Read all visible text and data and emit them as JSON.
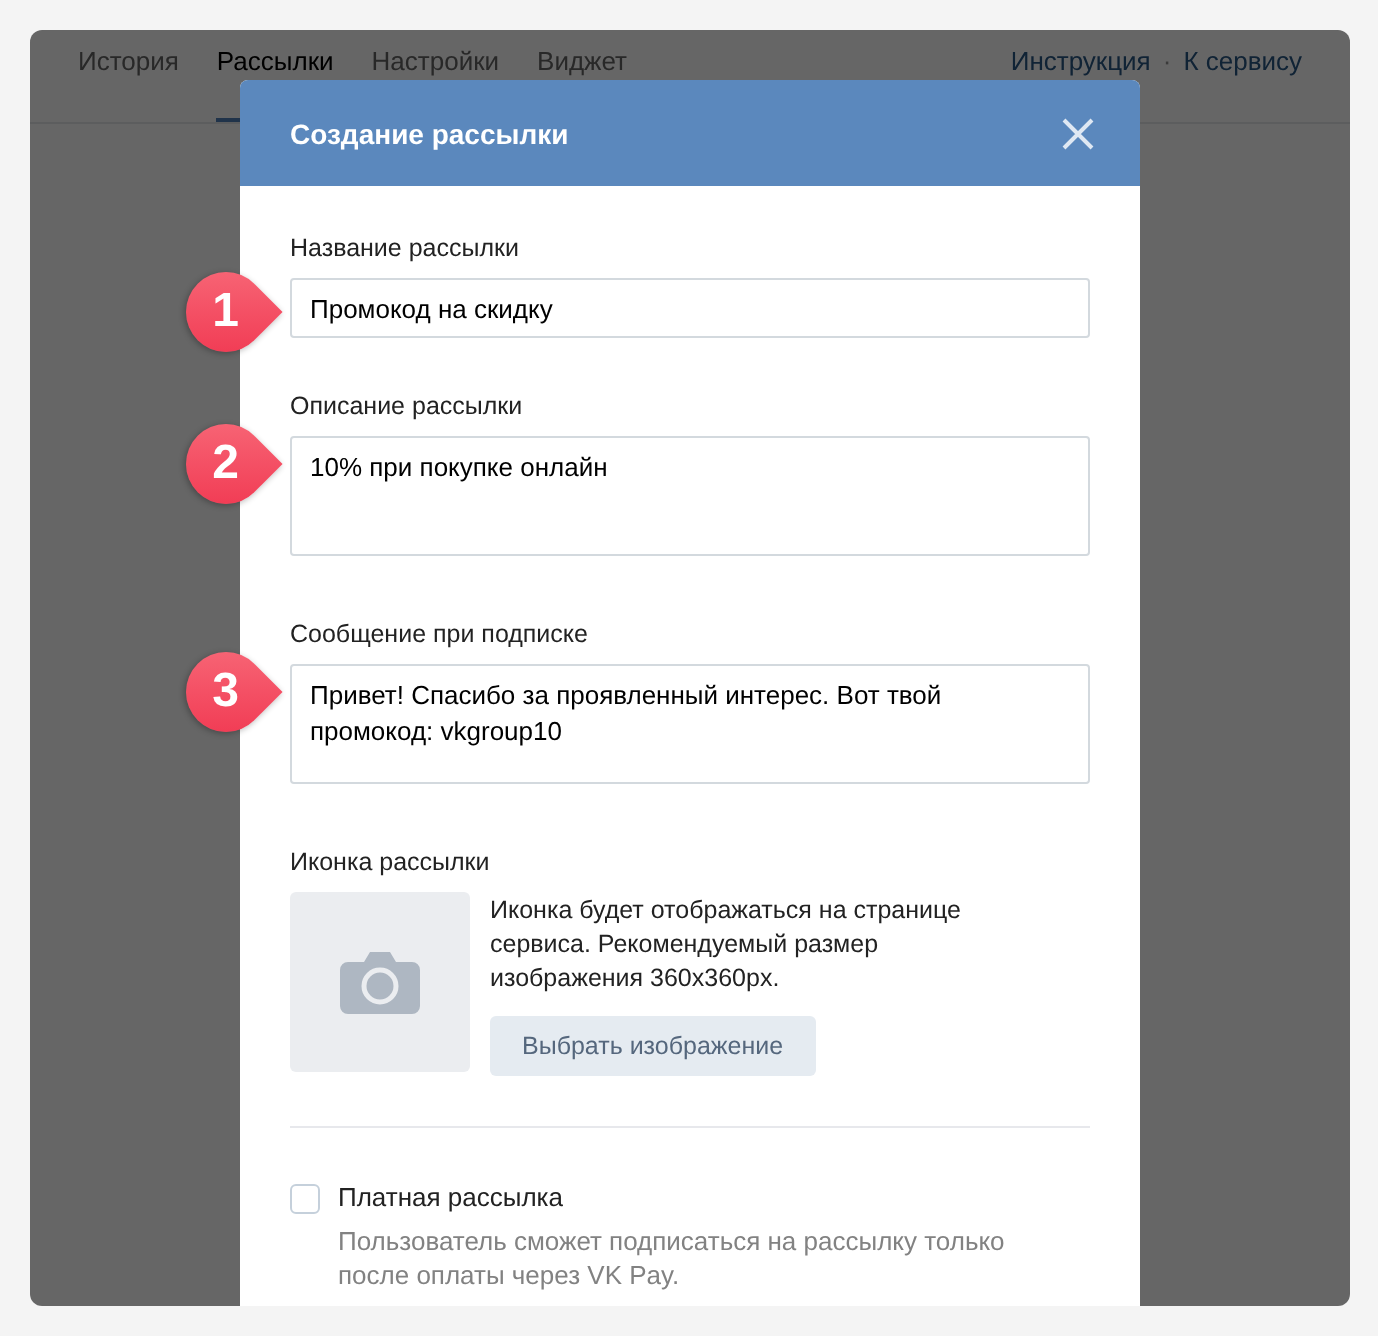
{
  "tabs": [
    {
      "label": "История",
      "selected": false
    },
    {
      "label": "Рассылки",
      "selected": true
    },
    {
      "label": "Настройки",
      "selected": false
    },
    {
      "label": "Виджет",
      "selected": false
    }
  ],
  "header_links": [
    "Инструкция",
    "К сервису"
  ],
  "header_separator": "·",
  "modal": {
    "title": "Создание рассылки",
    "fields": [
      {
        "kind": "input",
        "label": "Название рассылки",
        "value": "Промокод на скидку",
        "marker": "1"
      },
      {
        "kind": "textarea",
        "label": "Описание рассылки",
        "value": "10% при покупке онлайн",
        "marker": "2"
      },
      {
        "kind": "textarea",
        "label": "Сообщение при подписке",
        "value": "Привет! Спасибо за проявленный интерес. Вот твой промокод: vkgroup10",
        "marker": "3"
      }
    ],
    "icon_section": {
      "label": "Иконка рассылки",
      "hint": "Иконка будет отображаться на странице сервиса. Рекомендуемый размер изображения 360x360px.",
      "button": "Выбрать изображение"
    },
    "paid": {
      "label": "Платная рассылка",
      "checked": false,
      "description": "Пользователь сможет подписаться на рассылку только после оплаты через VK Pay."
    }
  }
}
